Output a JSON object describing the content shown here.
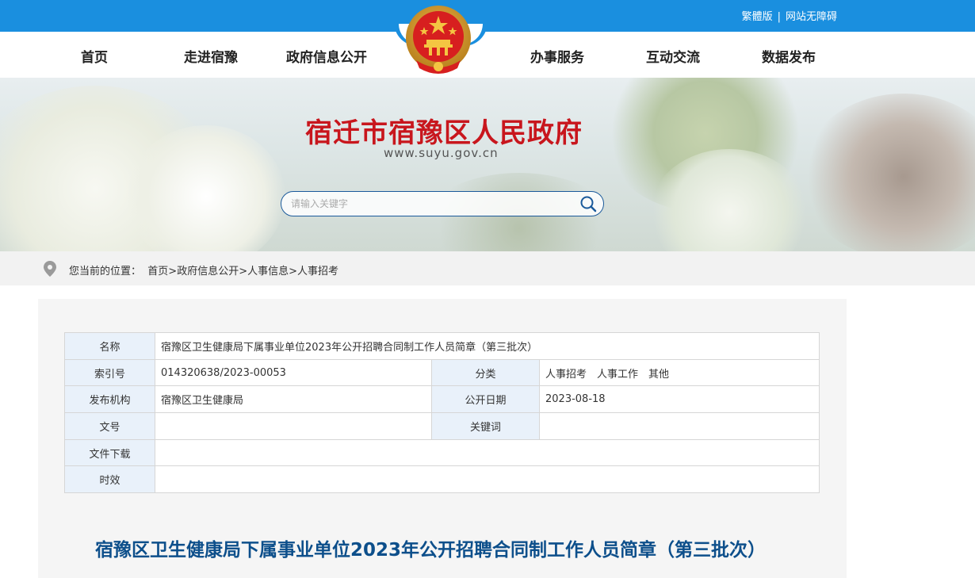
{
  "topbar": {
    "traditional": "繁體版",
    "separator": "|",
    "accessibility": "网站无障碍"
  },
  "nav": {
    "items": [
      "首页",
      "走进宿豫",
      "政府信息公开",
      "办事服务",
      "互动交流",
      "数据发布"
    ]
  },
  "banner": {
    "site_title": "宿迁市宿豫区人民政府",
    "site_url": "www.suyu.gov.cn"
  },
  "search": {
    "placeholder": "请输入关键字"
  },
  "breadcrumb": {
    "prefix": "您当前的位置：",
    "items": [
      "首页",
      "政府信息公开",
      "人事信息",
      "人事招考"
    ],
    "sep": ">"
  },
  "meta": {
    "name_label": "名称",
    "name_value": "宿豫区卫生健康局下属事业单位2023年公开招聘合同制工作人员简章（第三批次）",
    "index_label": "索引号",
    "index_value": "014320638/2023-00053",
    "category_label": "分类",
    "category_value": "人事招考　人事工作　其他",
    "publisher_label": "发布机构",
    "publisher_value": "宿豫区卫生健康局",
    "date_label": "公开日期",
    "date_value": "2023-08-18",
    "docno_label": "文号",
    "docno_value": "",
    "keywords_label": "关键词",
    "keywords_value": "",
    "download_label": "文件下载",
    "download_value": "",
    "validity_label": "时效",
    "validity_value": ""
  },
  "article": {
    "title": "宿豫区卫生健康局下属事业单位2023年公开招聘合同制工作人员简章（第三批次）"
  },
  "colors": {
    "topbar": "#1a8fdf",
    "title_red": "#c8161d",
    "article_blue": "#0d4f8b",
    "label_bg": "#e9f1fa"
  }
}
